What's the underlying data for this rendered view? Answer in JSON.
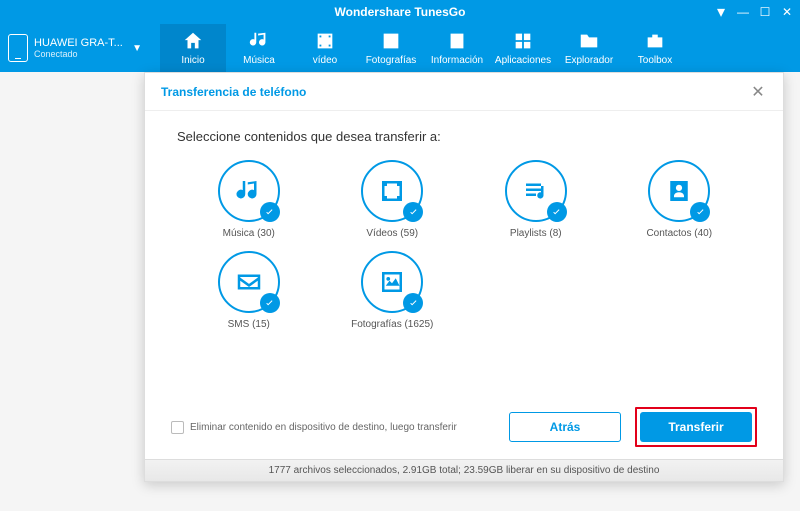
{
  "titlebar": {
    "title": "Wondershare TunesGo"
  },
  "device": {
    "name": "HUAWEI GRA-T...",
    "status": "Conectado"
  },
  "tabs": [
    {
      "key": "home",
      "label": "Inicio"
    },
    {
      "key": "music",
      "label": "Música"
    },
    {
      "key": "video",
      "label": "vídeo"
    },
    {
      "key": "photos",
      "label": "Fotografías"
    },
    {
      "key": "info",
      "label": "Información"
    },
    {
      "key": "apps",
      "label": "Aplicaciones"
    },
    {
      "key": "explorer",
      "label": "Explorador"
    },
    {
      "key": "toolbox",
      "label": "Toolbox"
    }
  ],
  "dialog": {
    "title": "Transferencia de teléfono",
    "heading": "Seleccione contenidos que desea transferir a:",
    "items": [
      {
        "key": "musica",
        "label": "Música (30)"
      },
      {
        "key": "videos",
        "label": "Vídeos (59)"
      },
      {
        "key": "playlists",
        "label": "Playlists (8)"
      },
      {
        "key": "contactos",
        "label": "Contactos (40)"
      },
      {
        "key": "sms",
        "label": "SMS (15)"
      },
      {
        "key": "fotos",
        "label": "Fotografías (1625)"
      }
    ],
    "delete_label": "Eliminar contenido en dispositivo de destino, luego transferir",
    "back_label": "Atrás",
    "transfer_label": "Transferir"
  },
  "statusbar": {
    "text": "1777 archivos seleccionados, 2.91GB total; 23.59GB liberar en su dispositivo de destino"
  }
}
